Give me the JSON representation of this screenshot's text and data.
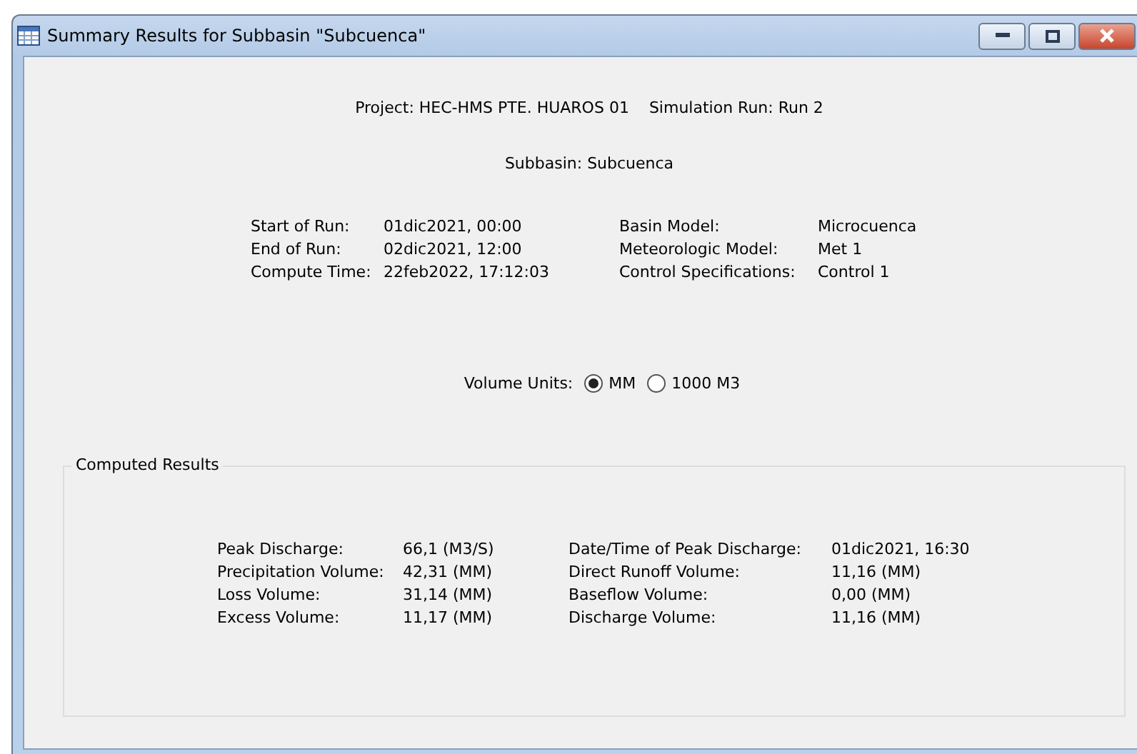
{
  "window": {
    "title": "Summary Results for Subbasin \"Subcuenca\""
  },
  "header": {
    "project_label": "Project:",
    "project": "HEC-HMS PTE. HUAROS 01",
    "run_label": "Simulation Run:",
    "run": "Run 2",
    "subbasin_label": "Subbasin:",
    "subbasin": "Subcuenca"
  },
  "run_info": [
    {
      "label": "Start of Run:",
      "value": "01dic2021, 00:00"
    },
    {
      "label": "End of Run:",
      "value": "02dic2021, 12:00"
    },
    {
      "label": "Compute Time:",
      "value": "22feb2022, 17:12:03"
    }
  ],
  "model_info": [
    {
      "label": "Basin Model:",
      "value": "Microcuenca"
    },
    {
      "label": "Meteorologic Model:",
      "value": "Met 1"
    },
    {
      "label": "Control Specifications:",
      "value": "Control 1"
    }
  ],
  "volume_units": {
    "label": "Volume Units:",
    "options": [
      {
        "label": "MM",
        "selected": true
      },
      {
        "label": "1000 M3",
        "selected": false
      }
    ]
  },
  "computed_results": {
    "title": "Computed Results",
    "left": [
      {
        "label": "Peak Discharge:",
        "value": "66,1 (M3/S)"
      },
      {
        "label": "Precipitation Volume:",
        "value": "42,31 (MM)"
      },
      {
        "label": "Loss Volume:",
        "value": "31,14 (MM)"
      },
      {
        "label": "Excess Volume:",
        "value": "11,17 (MM)"
      }
    ],
    "right": [
      {
        "label": "Date/Time of Peak Discharge:",
        "value": "01dic2021, 16:30"
      },
      {
        "label": "Direct Runoff Volume:",
        "value": "11,16 (MM)"
      },
      {
        "label": "Baseflow Volume:",
        "value": "0,00 (MM)"
      },
      {
        "label": "Discharge Volume:",
        "value": "11,16 (MM)"
      }
    ]
  }
}
